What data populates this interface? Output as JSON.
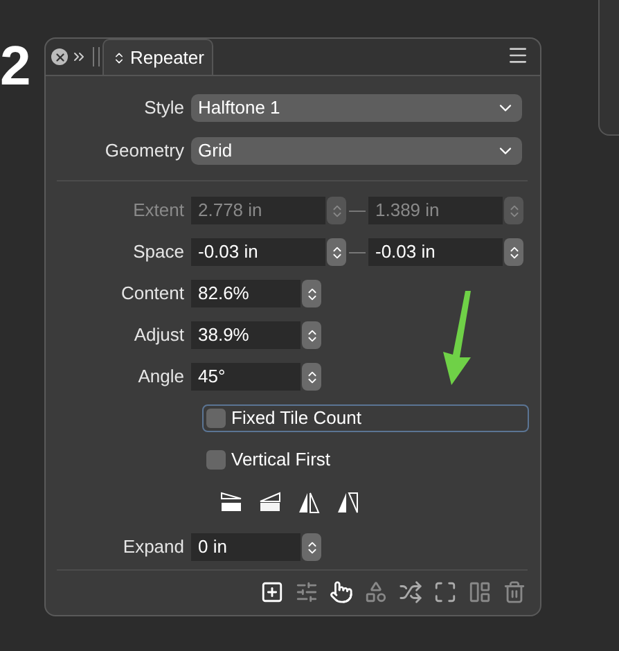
{
  "background_text": "2",
  "tab": {
    "title": "Repeater"
  },
  "dropdowns": [
    {
      "label": "Style",
      "value": "Halftone 1"
    },
    {
      "label": "Geometry",
      "value": "Grid"
    }
  ],
  "pair_fields": [
    {
      "label": "Extent",
      "values": [
        "2.778 in",
        "1.389 in"
      ],
      "disabled": true
    },
    {
      "label": "Space",
      "values": [
        "-0.03 in",
        "-0.03 in"
      ],
      "disabled": false
    }
  ],
  "fields": [
    {
      "label": "Content",
      "value": "82.6%"
    },
    {
      "label": "Adjust",
      "value": "38.9%"
    },
    {
      "label": "Angle",
      "value": "45°"
    }
  ],
  "checkboxes": [
    {
      "label": "Fixed Tile Count",
      "checked": false,
      "focused": true
    },
    {
      "label": "Vertical First",
      "checked": false,
      "focused": false
    }
  ],
  "expand": {
    "label": "Expand",
    "value": "0 in"
  }
}
